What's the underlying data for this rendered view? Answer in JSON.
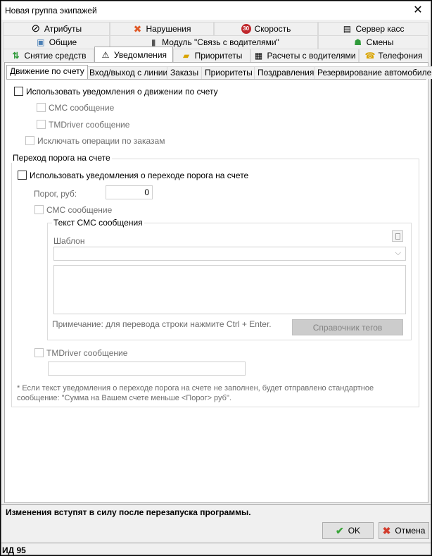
{
  "window": {
    "title": "Новая группа экипажей"
  },
  "tabs_row1": [
    {
      "label": "Атрибуты",
      "icon": "no-sign-icon",
      "glyph": "⊘",
      "color": "#000000"
    },
    {
      "label": "Нарушения",
      "icon": "red-x-icon",
      "glyph": "✖",
      "color": "#e05a28"
    },
    {
      "label": "Скорость",
      "icon": "speed-30-icon",
      "glyph": "30",
      "color": "#c0282d"
    },
    {
      "label": "Сервер касс",
      "icon": "cash-server-icon",
      "glyph": "▤",
      "color": "#333333"
    }
  ],
  "tabs_row2": [
    {
      "label": "Общие",
      "icon": "general-icon",
      "glyph": "▣",
      "color": "#4a7fb5"
    },
    {
      "label": "Модуль \"Связь с водителями\"",
      "icon": "module-icon",
      "glyph": "▮",
      "color": "#555555"
    },
    {
      "label": "Смены",
      "icon": "people-icon",
      "glyph": "☗",
      "color": "#2f9a3a"
    }
  ],
  "tabs_row3": [
    {
      "label": "Снятие средств",
      "icon": "money-withdraw-icon",
      "glyph": "⇅",
      "color": "#2f9a3a"
    },
    {
      "label": "Уведомления",
      "icon": "warning-icon",
      "glyph": "⚠",
      "color": "#000000"
    },
    {
      "label": "Приоритеты",
      "icon": "priority-icon",
      "glyph": "▰",
      "color": "#d9a400"
    },
    {
      "label": "Расчеты с водителями",
      "icon": "calculator-icon",
      "glyph": "▦",
      "color": "#333333"
    },
    {
      "label": "Телефония",
      "icon": "phone-icon",
      "glyph": "☎",
      "color": "#d9a400"
    }
  ],
  "subtabs": [
    "Движение по счету",
    "Вход/выход с линии",
    "Заказы",
    "Приоритеты",
    "Поздравления",
    "Резервирование автомобилей"
  ],
  "content": {
    "use_account_notifications": "Использовать уведомления о движении по счету",
    "sms_message": "СМС сообщение",
    "tmdriver_message": "TMDriver сообщение",
    "exclude_order_operations": "Исключать операции по заказам",
    "threshold_group_title": "Переход порога на счете",
    "use_threshold_notifications": "Использовать уведомления о переходе порога на счете",
    "threshold_label": "Порог, руб:",
    "threshold_value": "0",
    "sms_message2": "СМС сообщение",
    "sms_text_group_title": "Текст СМС сообщения",
    "template_label": "Шаблон",
    "note": "Примечание: для перевода строки нажмите Ctrl + Enter.",
    "tags_button": "Справочник тегов",
    "tmdriver_message2": "TMDriver сообщение",
    "footnote_line1": "* Если текст уведомления о переходе порога на счете не заполнен, будет отправлено стандартное",
    "footnote_line2": "сообщение: \"Сумма на Вашем счете меньше <Порог> руб\"."
  },
  "status_message": "Изменения вступят в силу после перезапуска программы.",
  "buttons": {
    "ok": "OK",
    "cancel": "Отмена"
  },
  "footer_id": "ИД 95"
}
